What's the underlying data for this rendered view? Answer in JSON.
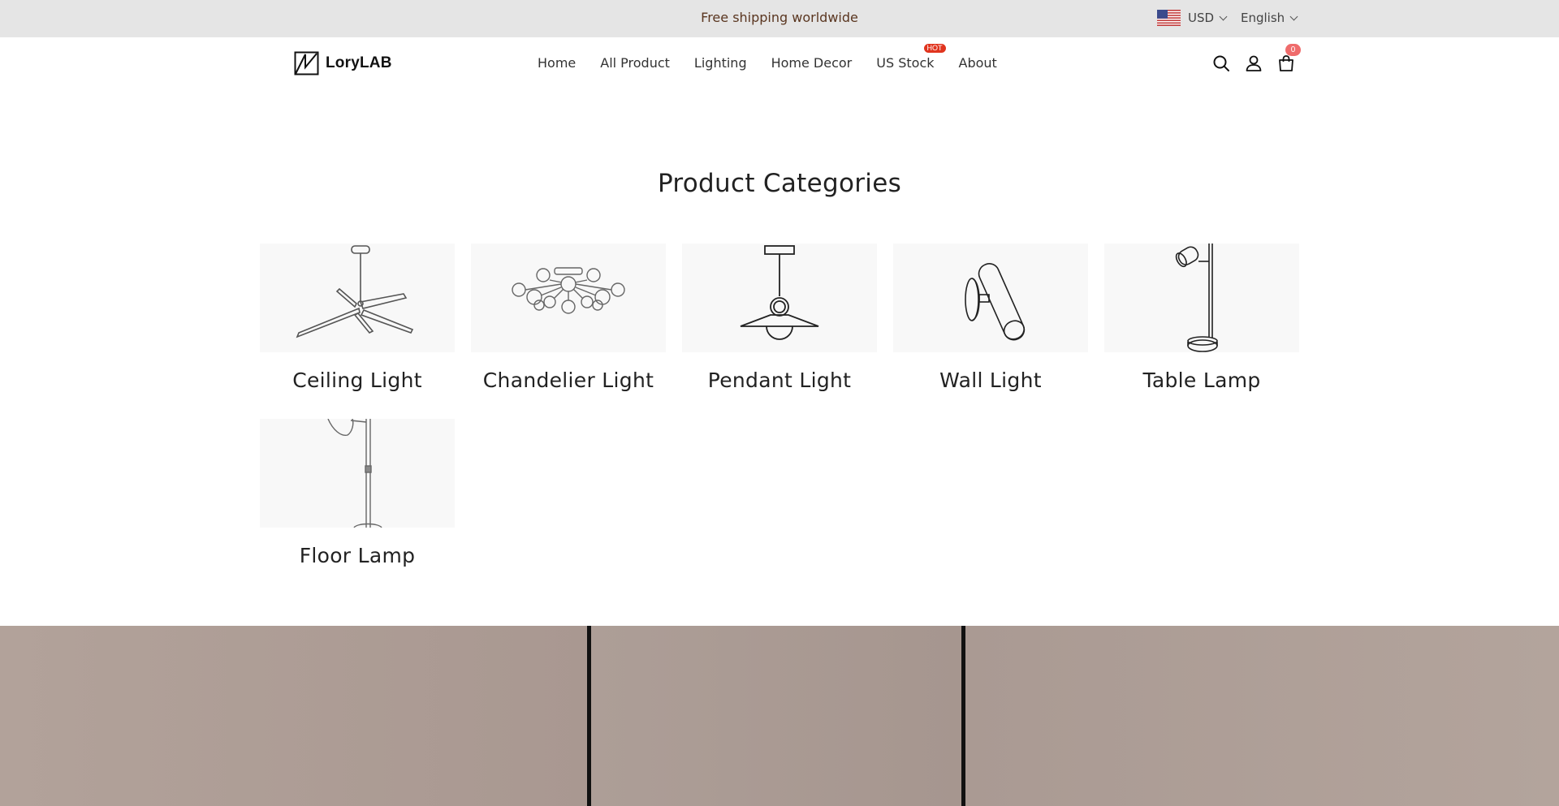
{
  "topbar": {
    "announcement": "Free shipping worldwide",
    "currency": "USD",
    "language": "English"
  },
  "header": {
    "logo_text": "LoryLAB",
    "nav": [
      {
        "label": "Home"
      },
      {
        "label": "All Product"
      },
      {
        "label": "Lighting"
      },
      {
        "label": "Home Decor"
      },
      {
        "label": "US Stock",
        "badge": "HOT"
      },
      {
        "label": "About"
      }
    ],
    "icons": [
      "search-icon",
      "account-icon",
      "cart-icon"
    ],
    "cart_count": "0"
  },
  "main": {
    "section_title": "Product Categories",
    "categories": [
      {
        "label": "Ceiling Light",
        "icon": "ceiling-light-icon"
      },
      {
        "label": "Chandelier Light",
        "icon": "chandelier-light-icon"
      },
      {
        "label": "Pendant Light",
        "icon": "pendant-light-icon"
      },
      {
        "label": "Wall Light",
        "icon": "wall-light-icon"
      },
      {
        "label": "Table Lamp",
        "icon": "table-lamp-icon"
      },
      {
        "label": "Floor Lamp",
        "icon": "floor-lamp-icon"
      }
    ]
  },
  "colors": {
    "topbar_bg": "#e5e5e5",
    "announcement_text": "#5a3620",
    "hot_badge": "#e0341e",
    "cart_badge": "#ef6b6b",
    "banner_bg": "#b3a39a"
  }
}
